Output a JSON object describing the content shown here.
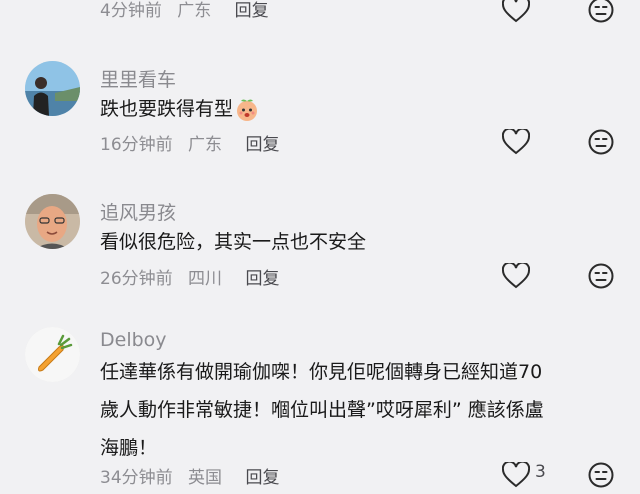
{
  "comments": [
    {
      "username": "",
      "text": "",
      "time": "4分钟前",
      "location": "广东",
      "reply_label": "回复",
      "likes": ""
    },
    {
      "username": "里里看车",
      "text": "跌也要跌得有型",
      "time": "16分钟前",
      "location": "广东",
      "reply_label": "回复",
      "likes": ""
    },
    {
      "username": "追风男孩",
      "text": "看似很危险，其实一点也不安全",
      "time": "26分钟前",
      "location": "四川",
      "reply_label": "回复",
      "likes": ""
    },
    {
      "username": "Delboy",
      "text_lines": [
        "任達華係有做開瑜伽㗎！你見佢呢個轉身已經知道70",
        "歲人動作非常敏捷！嗰位叫出聲”哎呀犀利” 應該係盧",
        "海鵬！"
      ],
      "time": "34分钟前",
      "location": "英国",
      "reply_label": "回复",
      "likes": "3"
    }
  ],
  "icons": {
    "like": "heart-outline-icon",
    "dislike": "neutral-face-icon",
    "sticker": "peach-emoji-icon"
  },
  "colors": {
    "background": "#f1f1f3",
    "username": "#8a8a8f",
    "text": "#1a1a1a",
    "meta": "#8d8d92"
  }
}
